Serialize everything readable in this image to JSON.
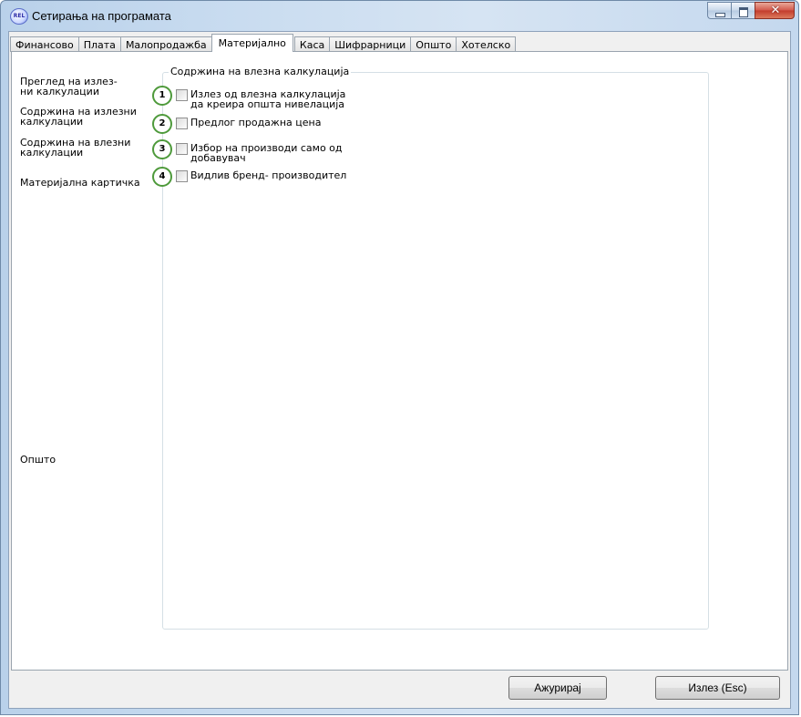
{
  "window": {
    "title": "Сетирања на програмата",
    "icon_text": "REL"
  },
  "tabs": [
    {
      "label": "Финансово",
      "active": false
    },
    {
      "label": "Плата",
      "active": false
    },
    {
      "label": "Малопродажба",
      "active": false
    },
    {
      "label": "Материјално",
      "active": true
    },
    {
      "label": "Каса",
      "active": false
    },
    {
      "label": "Шифрарници",
      "active": false
    },
    {
      "label": "Општо",
      "active": false
    },
    {
      "label": "Хотелско",
      "active": false
    }
  ],
  "sidebar": {
    "items": [
      {
        "line1": "Преглед на излез-",
        "line2": "ни калкулации"
      },
      {
        "line1": "Содржина на излезни",
        "line2": "калкулации"
      },
      {
        "line1": "Содржина на влезни",
        "line2": "калкулации"
      },
      {
        "line1": "Материјална картичка",
        "line2": ""
      },
      {
        "line1": "Општо",
        "line2": ""
      }
    ]
  },
  "group": {
    "title": "Содржина на влезна калкулација",
    "options": [
      {
        "number": "1",
        "line1": "Излез од влезна калкулација",
        "line2": "да креира општа нивелација",
        "checked": false
      },
      {
        "number": "2",
        "line1": "Предлог продажна цена",
        "line2": "",
        "checked": false
      },
      {
        "number": "3",
        "line1": "Избор на производи само од",
        "line2": "добавувач",
        "checked": false
      },
      {
        "number": "4",
        "line1": "Видлив бренд- производител",
        "line2": "",
        "checked": false
      }
    ]
  },
  "buttons": {
    "update_label": "Ажурирај",
    "exit_label": "Излез (Esc)"
  },
  "colors": {
    "accent_circle": "#4e9a3b",
    "close_button": "#c23b2c"
  }
}
